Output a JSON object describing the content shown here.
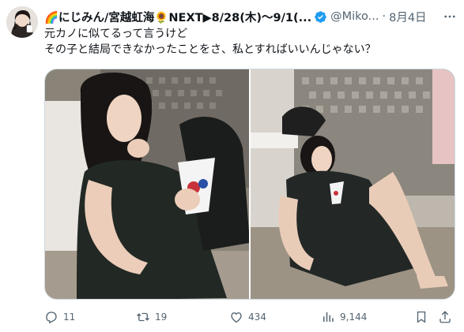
{
  "tweet": {
    "author": {
      "display_name": "🌈にじみん/宮越虹海🌻NEXT▶8/28(木)〜9/1(...",
      "handle": "@Miko...",
      "verified": true
    },
    "timestamp": "8月4日",
    "text_line1": "元カノに似てるって言うけど",
    "text_line2": "その子と結局できなかったことをさ、私とすればいいんじゃない？",
    "media": [
      {
        "alt": "photo-1"
      },
      {
        "alt": "photo-2"
      }
    ],
    "actions": {
      "replies": "11",
      "retweets": "19",
      "likes": "434",
      "views": "9,144"
    }
  },
  "colors": {
    "text": "#0f1419",
    "secondary": "#536471",
    "verified": "#1d9bf0",
    "border": "#cfd9de"
  },
  "icons": {
    "more": "more-icon",
    "verified": "verified-badge-icon",
    "reply": "reply-icon",
    "retweet": "retweet-icon",
    "like": "heart-icon",
    "views": "views-icon",
    "bookmark": "bookmark-icon",
    "share": "share-icon"
  }
}
